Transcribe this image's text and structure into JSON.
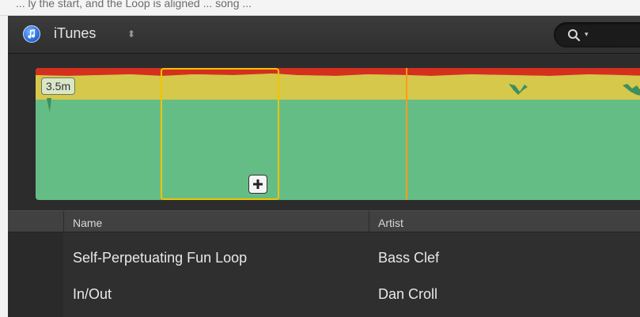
{
  "top_strip": {
    "text": "... ly the start, and the Loop is aligned ... song ..."
  },
  "app": {
    "title": "iTunes",
    "title_switch_arrows": "⬍"
  },
  "search": {
    "icon": "search-icon",
    "dropdown_glyph": "▾"
  },
  "waveform": {
    "duration_label": "3.5m",
    "colors": {
      "wave_fill": "#65bd86",
      "peak_red": "#d5301e",
      "peak_yellow": "#d6c84a",
      "selection": "#f0c400",
      "playhead": "#ff9a1e"
    },
    "add_button_glyph": "+"
  },
  "table": {
    "columns": [
      "Name",
      "Artist"
    ],
    "rows": [
      {
        "name": "Self-Perpetuating Fun Loop",
        "artist": "Bass Clef"
      },
      {
        "name": "In/Out",
        "artist": "Dan Croll"
      }
    ]
  }
}
